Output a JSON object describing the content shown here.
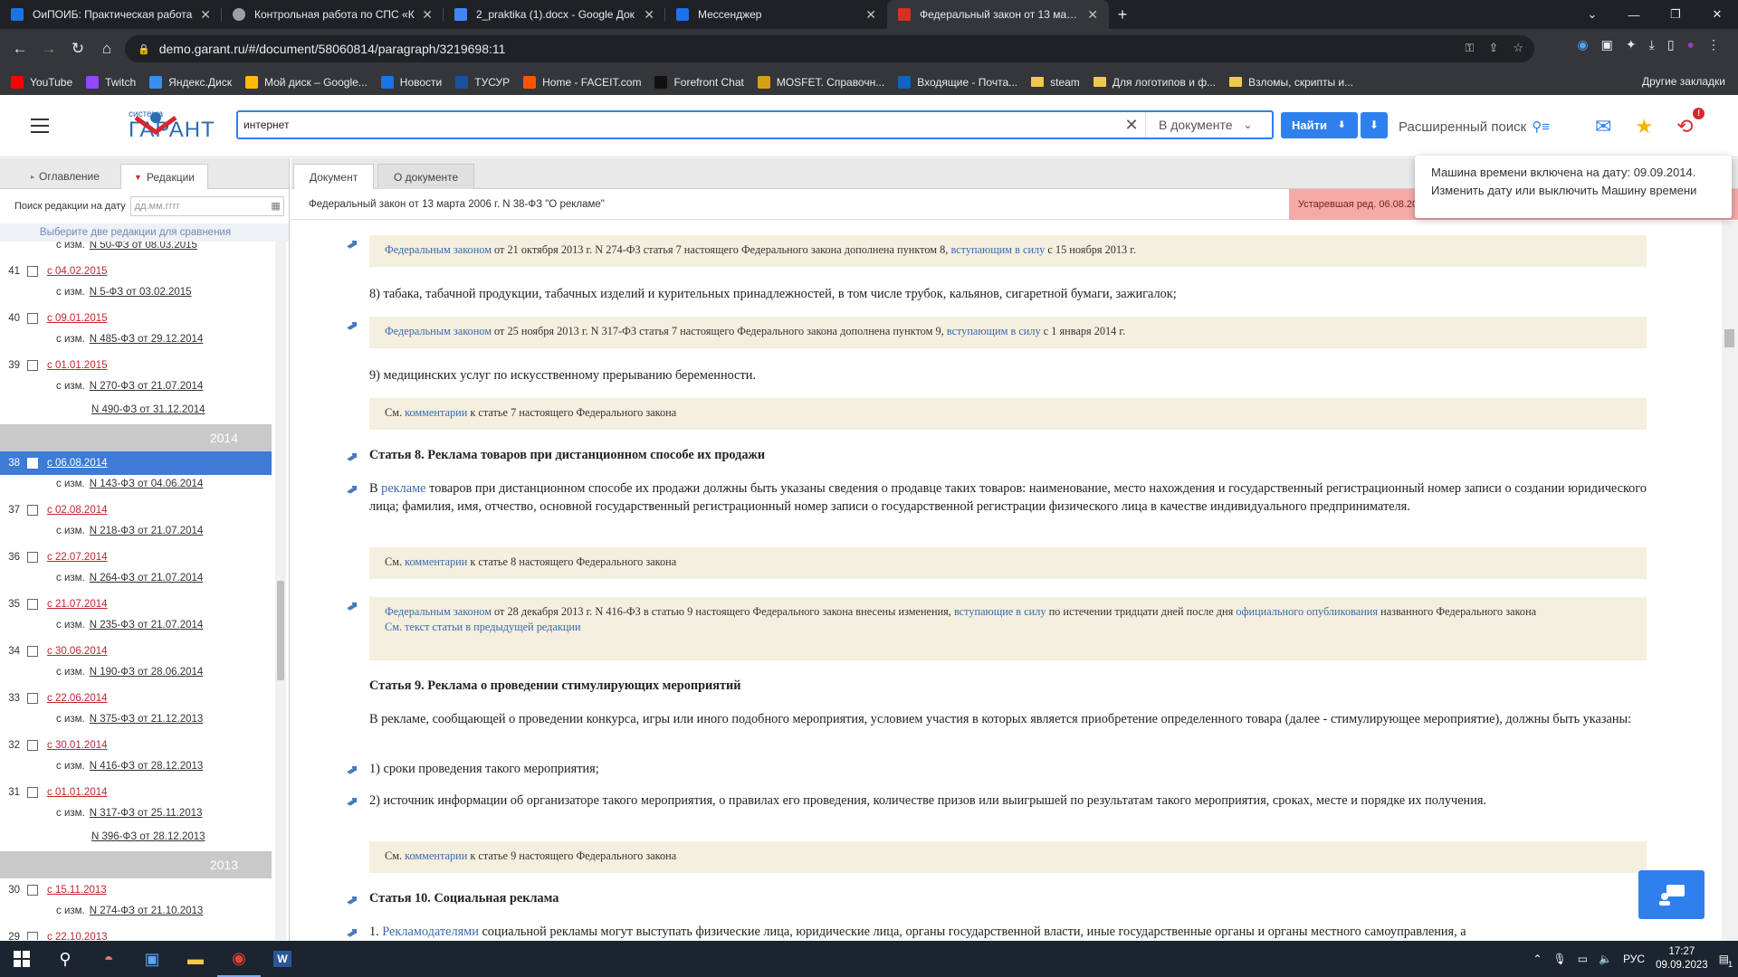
{
  "browser": {
    "tabs": [
      {
        "title": "ОиПОИБ: Практическая работа",
        "color": "#1a73e8"
      },
      {
        "title": "Контрольная работа по СПС «К",
        "color": "#9aa0a6"
      },
      {
        "title": "2_praktika (1).docx - Google Док",
        "color": "#4285f4"
      },
      {
        "title": "Мессенджер",
        "color": "#1a73e8"
      },
      {
        "title": "Федеральный закон от 13 марта",
        "color": "#d93025"
      }
    ],
    "close_glyph": "✕",
    "newtab_glyph": "+",
    "url": "demo.garant.ru/#/document/58060814/paragraph/3219698:11",
    "bookmarks": [
      {
        "label": "YouTube",
        "color": "#ff0000",
        "kind": "icon"
      },
      {
        "label": "Twitch",
        "color": "#9146ff",
        "kind": "icon"
      },
      {
        "label": "Яндекс.Диск",
        "color": "#3a8ef0",
        "kind": "icon"
      },
      {
        "label": "Мой диск – Google...",
        "color": "#fbbc04",
        "kind": "icon"
      },
      {
        "label": "Новости",
        "color": "#1a73e8",
        "kind": "icon"
      },
      {
        "label": "ТУСУР",
        "color": "#1b4fa0",
        "kind": "icon"
      },
      {
        "label": "Home - FACEIT.com",
        "color": "#ff5500",
        "kind": "icon"
      },
      {
        "label": "Forefront Chat",
        "color": "#111111",
        "kind": "icon"
      },
      {
        "label": "MOSFET. Справочн...",
        "color": "#d4a017",
        "kind": "icon"
      },
      {
        "label": "Входящие - Почта...",
        "color": "#0a66c2",
        "kind": "icon"
      },
      {
        "label": "steam",
        "kind": "folder"
      },
      {
        "label": "Для логотипов и ф...",
        "kind": "folder"
      },
      {
        "label": "Взломы, скрипты и...",
        "kind": "folder"
      }
    ],
    "other_bookmarks": "Другие закладки"
  },
  "header": {
    "logo_small": "система",
    "logo_big": "ГАРАНТ",
    "search_value": "интернет",
    "scope": "В документе",
    "find": "Найти",
    "advanced": "Расширенный поиск",
    "notif_badge": "!"
  },
  "tooltip": {
    "line1": "Машина времени включена на дату: 09.09.2014.",
    "line2": "Изменить дату или выключить Машину времени"
  },
  "sidebar": {
    "tab_toc": "Оглавление",
    "tab_editions": "Редакции",
    "date_label": "Поиск редакции на дату",
    "date_placeholder": "дд.мм.гггг",
    "compare_hint": "Выберите две редакции для сравнения",
    "top_change": {
      "prefix": "с изм.",
      "law": "N 50-ФЗ от 08.03.2015"
    },
    "years": [
      "2014",
      "2013"
    ],
    "versions": [
      {
        "n": "41",
        "date": "с 04.02.2015",
        "changes": [
          "N 5-ФЗ от 03.02.2015"
        ]
      },
      {
        "n": "40",
        "date": "с 09.01.2015",
        "changes": [
          "N 485-ФЗ от 29.12.2014"
        ]
      },
      {
        "n": "39",
        "date": "с 01.01.2015",
        "changes": [
          "N 270-ФЗ от 21.07.2014",
          "N 490-ФЗ от 31.12.2014"
        ]
      },
      {
        "n": "38",
        "date": "с 06.08.2014",
        "changes": [
          "N 143-ФЗ от 04.06.2014"
        ],
        "selected": true
      },
      {
        "n": "37",
        "date": "с 02.08.2014",
        "changes": [
          "N 218-ФЗ от 21.07.2014"
        ]
      },
      {
        "n": "36",
        "date": "с 22.07.2014",
        "changes": [
          "N 264-ФЗ от 21.07.2014"
        ]
      },
      {
        "n": "35",
        "date": "с 21.07.2014",
        "changes": [
          "N 235-ФЗ от 21.07.2014"
        ]
      },
      {
        "n": "34",
        "date": "с 30.06.2014",
        "changes": [
          "N 190-ФЗ от 28.06.2014"
        ]
      },
      {
        "n": "33",
        "date": "с 22.06.2014",
        "changes": [
          "N 375-ФЗ от 21.12.2013"
        ]
      },
      {
        "n": "32",
        "date": "с 30.01.2014",
        "changes": [
          "N 416-ФЗ от 28.12.2013"
        ]
      },
      {
        "n": "31",
        "date": "с 01.01.2014",
        "changes": [
          "N 317-ФЗ от 25.11.2013",
          "N 396-ФЗ от 28.12.2013"
        ]
      },
      {
        "n": "30",
        "date": "с 15.11.2013",
        "changes": [
          "N 274-ФЗ от 21.10.2013"
        ]
      },
      {
        "n": "29",
        "date": "с 22.10.2013",
        "changes": []
      }
    ],
    "changes_prefix": "с изм."
  },
  "doc_tabs": {
    "document": "Документ",
    "about": "О документе"
  },
  "doc_title": "Федеральный закон от 13 марта 2006 г. N 38-ФЗ \"О рекламе\"",
  "expired_label": "Устаревшая ред. 06.08.20",
  "doc": {
    "n1": {
      "link": "Федеральным законом",
      "t1": " от 21 октября 2013 г. N 274-ФЗ статья 7 настоящего Федерального закона дополнена пунктом 8, ",
      "link2": "вступающим в силу",
      "t2": " с 15 ноября 2013 г."
    },
    "p8": "8) табака, табачной продукции, табачных изделий и курительных принадлежностей, в том числе трубок, кальянов, сигаретной бумаги, зажигалок;",
    "n2": {
      "link": "Федеральным законом",
      "t1": " от 25 ноября 2013 г. N 317-ФЗ статья 7 настоящего Федерального закона дополнена пунктом 9, ",
      "link2": "вступающим в силу",
      "t2": " с 1 января 2014 г."
    },
    "p9": "9) медицинских услуг по искусственному прерыванию беременности.",
    "c7": {
      "pre": "См. ",
      "link": "комментарии",
      "post": " к статье 7 настоящего Федерального закона"
    },
    "h8": "Статья 8. Реклама товаров при дистанционном способе их продажи",
    "a8": {
      "pre": "В ",
      "link": "рекламе",
      "post": " товаров при дистанционном способе их продажи должны быть указаны сведения о продавце таких товаров: наименование, место нахождения и государственный регистрационный номер записи о создании юридического лица; фамилия, имя, отчество, основной государственный регистрационный номер записи о государственной регистрации физического лица в качестве индивидуального предпринимателя."
    },
    "c8": {
      "pre": "См. ",
      "link": "комментарии",
      "post": " к статье 8 настоящего Федерального закона"
    },
    "n3": {
      "link": "Федеральным законом",
      "t1": " от 28 декабря 2013 г. N 416-ФЗ в статью 9 настоящего Федерального закона внесены изменения, ",
      "link2": "вступающие в силу",
      "t2": " по истечении тридцати дней после дня ",
      "link3": "официального опубликования",
      "t3": " названного Федерального закона",
      "link4": "См. текст статьи в предыдущей редакции"
    },
    "h9": "Статья 9. Реклама о проведении стимулирующих мероприятий",
    "a9": "В рекламе, сообщающей о проведении конкурса, игры или иного подобного мероприятия, условием участия в которых является приобретение определенного товара (далее - стимулирующее мероприятие), должны быть указаны:",
    "a9_1": "1) сроки проведения такого мероприятия;",
    "a9_2": "2) источник информации об организаторе такого мероприятия, о правилах его проведения, количестве призов или выигрышей по результатам такого мероприятия, сроках, месте и порядке их получения.",
    "c9": {
      "pre": "См. ",
      "link": "комментарии",
      "post": " к статье 9 настоящего Федерального закона"
    },
    "h10": "Статья 10. Социальная реклама",
    "a10": {
      "pre": "1. ",
      "link": "Рекламодателями",
      "post": " социальной рекламы могут выступать физические лица, юридические лица, органы государственной власти, иные государственные органы и органы местного самоуправления, а"
    }
  },
  "taskbar": {
    "lang": "РУС",
    "time": "17:27",
    "date": "09.09.2023",
    "notif": "1"
  }
}
